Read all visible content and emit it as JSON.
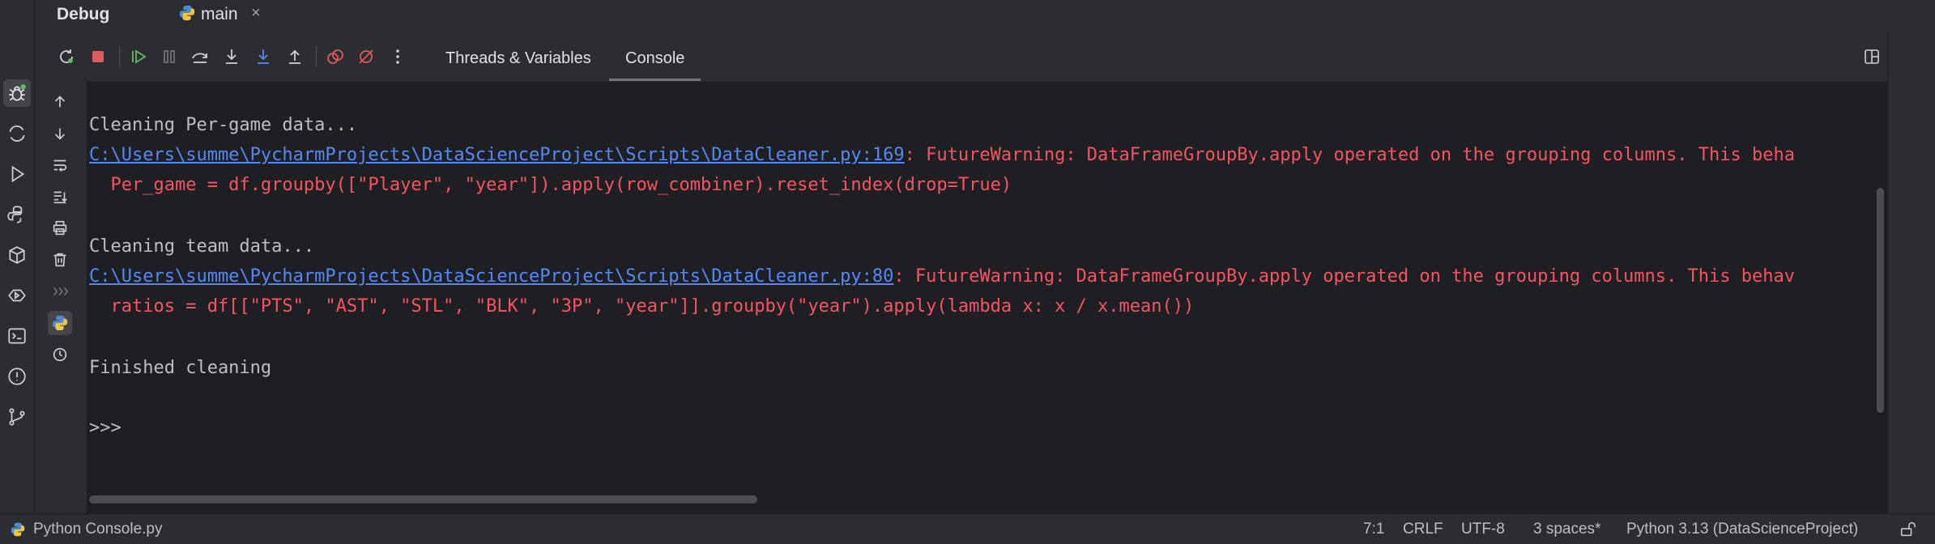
{
  "header": {
    "title": "Debug",
    "tab": {
      "label": "main",
      "close": "×"
    }
  },
  "toolbar": {
    "tabs": [
      {
        "label": "Threads & Variables",
        "active": false
      },
      {
        "label": "Console",
        "active": true
      }
    ],
    "buttons": [
      "rerun-icon",
      "stop-icon",
      "resume-icon",
      "pause-icon",
      "step-over-icon",
      "step-into-icon",
      "step-into-my-code-icon",
      "step-out-icon",
      "view-breakpoints-icon",
      "mute-breakpoints-icon",
      "more-icon"
    ]
  },
  "console": {
    "lines": [
      {
        "type": "plain",
        "text": "Cleaning Per-game data..."
      },
      {
        "type": "warning",
        "link": "C:\\Users\\summe\\PycharmProjects\\DataScienceProject\\Scripts\\DataCleaner.py:169",
        "message": ": FutureWarning: DataFrameGroupBy.apply operated on the grouping columns. This beha"
      },
      {
        "type": "error",
        "text": "  Per_game = df.groupby([\"Player\", \"year\"]).apply(row_combiner).reset_index(drop=True)"
      },
      {
        "type": "blank",
        "text": ""
      },
      {
        "type": "plain",
        "text": "Cleaning team data..."
      },
      {
        "type": "warning",
        "link": "C:\\Users\\summe\\PycharmProjects\\DataScienceProject\\Scripts\\DataCleaner.py:80",
        "message": ": FutureWarning: DataFrameGroupBy.apply operated on the grouping columns. This behav"
      },
      {
        "type": "error",
        "text": "  ratios = df[[\"PTS\", \"AST\", \"STL\", \"BLK\", \"3P\", \"year\"]].groupby(\"year\").apply(lambda x: x / x.mean())"
      },
      {
        "type": "blank",
        "text": ""
      },
      {
        "type": "plain",
        "text": "Finished cleaning"
      },
      {
        "type": "blank",
        "text": ""
      },
      {
        "type": "prompt",
        "text": ">>>"
      }
    ]
  },
  "status_bar": {
    "file": "Python Console.py",
    "position": "7:1",
    "line_separator": "CRLF",
    "encoding": "UTF-8",
    "indent": "3 spaces*",
    "interpreter": "Python 3.13 (DataScienceProject)"
  },
  "colors": {
    "background": "#1e1f22",
    "panel": "#2b2d30",
    "error": "#f75464",
    "link": "#548af7",
    "accent": "#3574f0"
  }
}
